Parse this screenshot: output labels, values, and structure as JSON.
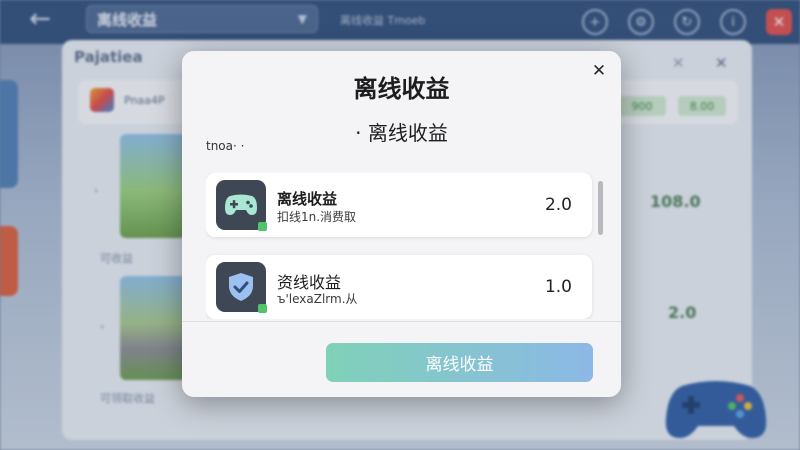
{
  "background": {
    "title": "离线收益",
    "top_hint": "离线收益 Tmoeb",
    "panel_title": "Pajatiea",
    "row_label": "Pnaa4P",
    "row_values": [
      "900",
      "8.00"
    ],
    "thumb_captions": [
      "可收益",
      "可领取收益"
    ],
    "side_values": [
      "108.0",
      "2.0"
    ]
  },
  "modal": {
    "title": "离线收益",
    "subtitle": "· 离线收益",
    "note": "tnoa· ·",
    "items": [
      {
        "title": "离线收益",
        "subtitle": "扣线1n.消费取",
        "value": "2.0",
        "icon": "gamepad-icon",
        "color": "#3f4654"
      },
      {
        "title": "资线收益",
        "subtitle": "ъ'lexaZlrm.从",
        "value": "1.0",
        "icon": "shield-check-icon",
        "color": "#3f4654"
      }
    ],
    "button_label": "离线收益",
    "colors": {
      "button_start": "#7fd1b8",
      "button_end": "#8cb8e6",
      "badge": "#4fc46b"
    }
  }
}
